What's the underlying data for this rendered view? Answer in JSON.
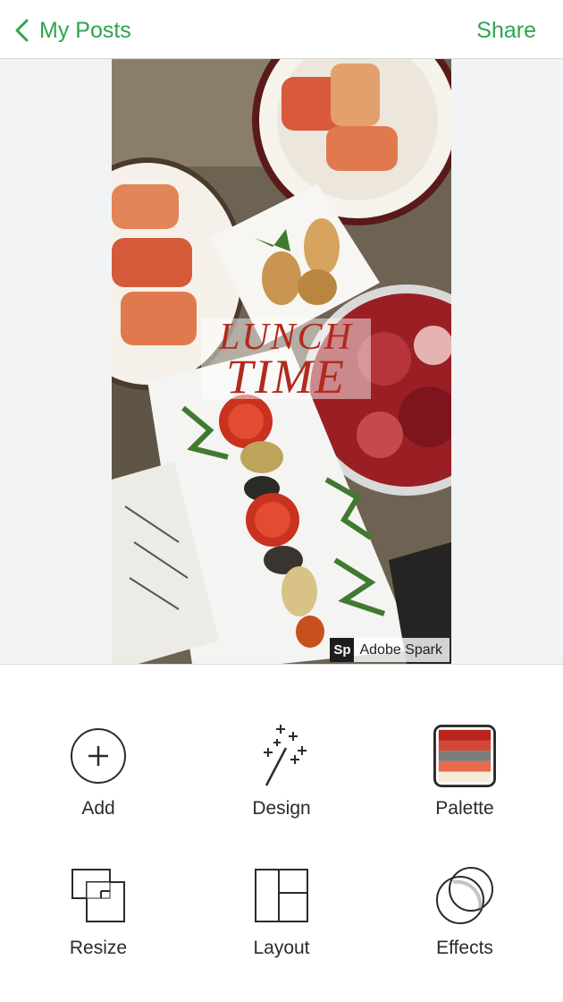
{
  "header": {
    "back_label": "My Posts",
    "share_label": "Share"
  },
  "post": {
    "headline_line1": "LUNCH",
    "headline_line2": "TIME",
    "badge_mark": "Sp",
    "badge_text": "Adobe Spark"
  },
  "tools": [
    {
      "label": "Add",
      "icon": "plus-circle-icon"
    },
    {
      "label": "Design",
      "icon": "magic-wand-icon"
    },
    {
      "label": "Palette",
      "icon": "palette-swatch-icon"
    },
    {
      "label": "Resize",
      "icon": "resize-icon"
    },
    {
      "label": "Layout",
      "icon": "layout-icon"
    },
    {
      "label": "Effects",
      "icon": "effects-icon"
    }
  ],
  "colors": {
    "accent": "#2fa44f",
    "headline": "#b22a1e",
    "palette": [
      "#b8241c",
      "#d2493a",
      "#7a7d78",
      "#e86a4f",
      "#f4ecd5"
    ]
  }
}
